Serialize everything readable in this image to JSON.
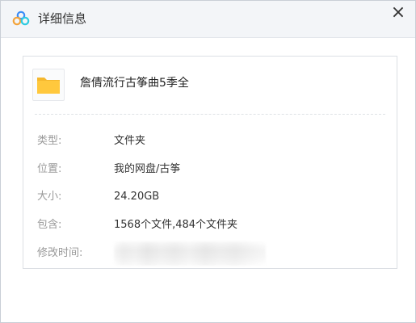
{
  "window": {
    "title": "详细信息",
    "app_icon": "cloud-logo-icon",
    "close_glyph": "×",
    "brand_colors": [
      "#3b8cf7",
      "#f3a33a",
      "#2ecbe0"
    ]
  },
  "file": {
    "icon": "folder-icon",
    "folder_color": "#ffc83d",
    "name": "詹倩流行古筝曲5季全"
  },
  "details": {
    "type": {
      "label": "类型:",
      "value": "文件夹"
    },
    "location": {
      "label": "位置:",
      "value": "我的网盘/古筝"
    },
    "size": {
      "label": "大小:",
      "value": "24.20GB"
    },
    "contains": {
      "label": "包含:",
      "value": "1568个文件,484个文件夹"
    },
    "modified": {
      "label": "修改时间:",
      "value": ""
    }
  }
}
